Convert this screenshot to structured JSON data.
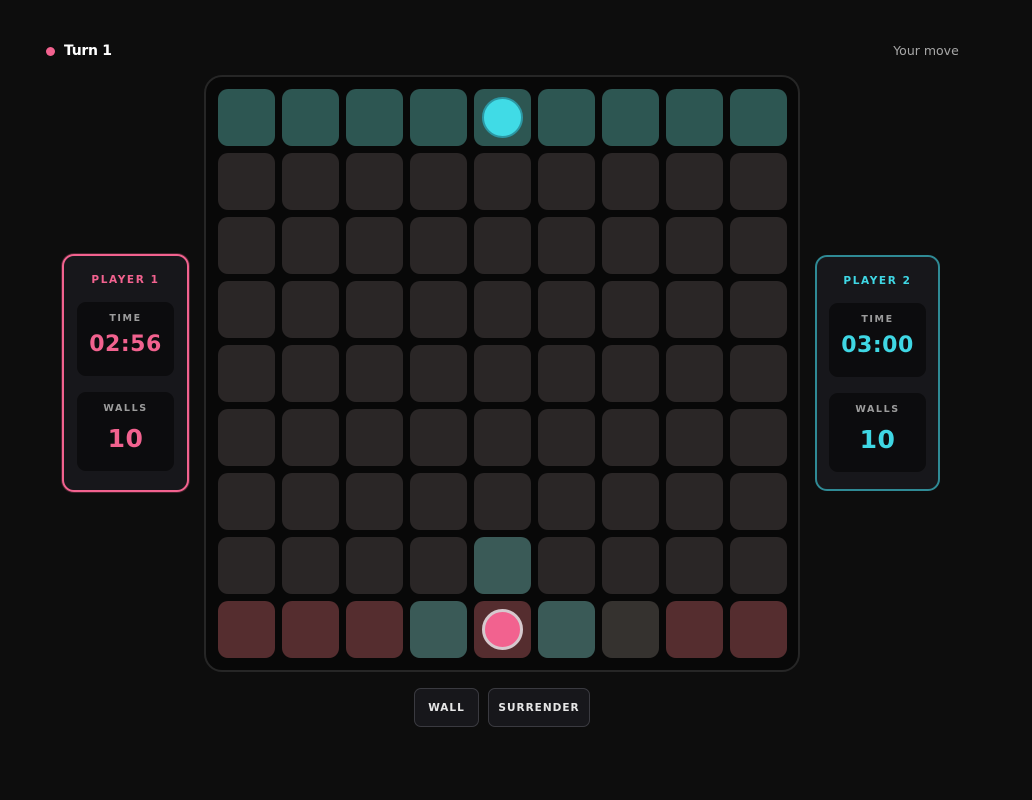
{
  "header": {
    "turn_label": "Turn 1",
    "status": "Your move"
  },
  "players": [
    {
      "title": "PLAYER 1",
      "time_label": "TIME",
      "time": "02:56",
      "walls_label": "WALLS",
      "walls": "10",
      "color": "#f2628f"
    },
    {
      "title": "PLAYER 2",
      "time_label": "TIME",
      "time": "03:00",
      "walls_label": "WALLS",
      "walls": "10",
      "color": "#3fd7e4"
    }
  ],
  "board": {
    "size": 9,
    "rows": [
      [
        "goal-p2",
        "goal-p2",
        "goal-p2",
        "goal-p2",
        "goal-p2",
        "goal-p2",
        "goal-p2",
        "goal-p2",
        "goal-p2"
      ],
      [
        "empty",
        "empty",
        "empty",
        "empty",
        "empty",
        "empty",
        "empty",
        "empty",
        "empty"
      ],
      [
        "empty",
        "empty",
        "empty",
        "empty",
        "empty",
        "empty",
        "empty",
        "empty",
        "empty"
      ],
      [
        "empty",
        "empty",
        "empty",
        "empty",
        "empty",
        "empty",
        "empty",
        "empty",
        "empty"
      ],
      [
        "empty",
        "empty",
        "empty",
        "empty",
        "empty",
        "empty",
        "empty",
        "empty",
        "empty"
      ],
      [
        "empty",
        "empty",
        "empty",
        "empty",
        "empty",
        "empty",
        "empty",
        "empty",
        "empty"
      ],
      [
        "empty",
        "empty",
        "empty",
        "empty",
        "empty",
        "empty",
        "empty",
        "empty",
        "empty"
      ],
      [
        "empty",
        "empty",
        "empty",
        "empty",
        "move",
        "empty",
        "empty",
        "empty",
        "empty"
      ],
      [
        "goal-p1",
        "goal-p1",
        "goal-p1",
        "move",
        "goal-p1",
        "move",
        "blocked",
        "goal-p1",
        "goal-p1"
      ]
    ],
    "pawns": [
      {
        "player": "p2",
        "row": 0,
        "col": 4
      },
      {
        "player": "p1",
        "row": 8,
        "col": 4
      }
    ]
  },
  "actions": {
    "wall_label": "WALL",
    "surrender_label": "SURRENDER"
  }
}
